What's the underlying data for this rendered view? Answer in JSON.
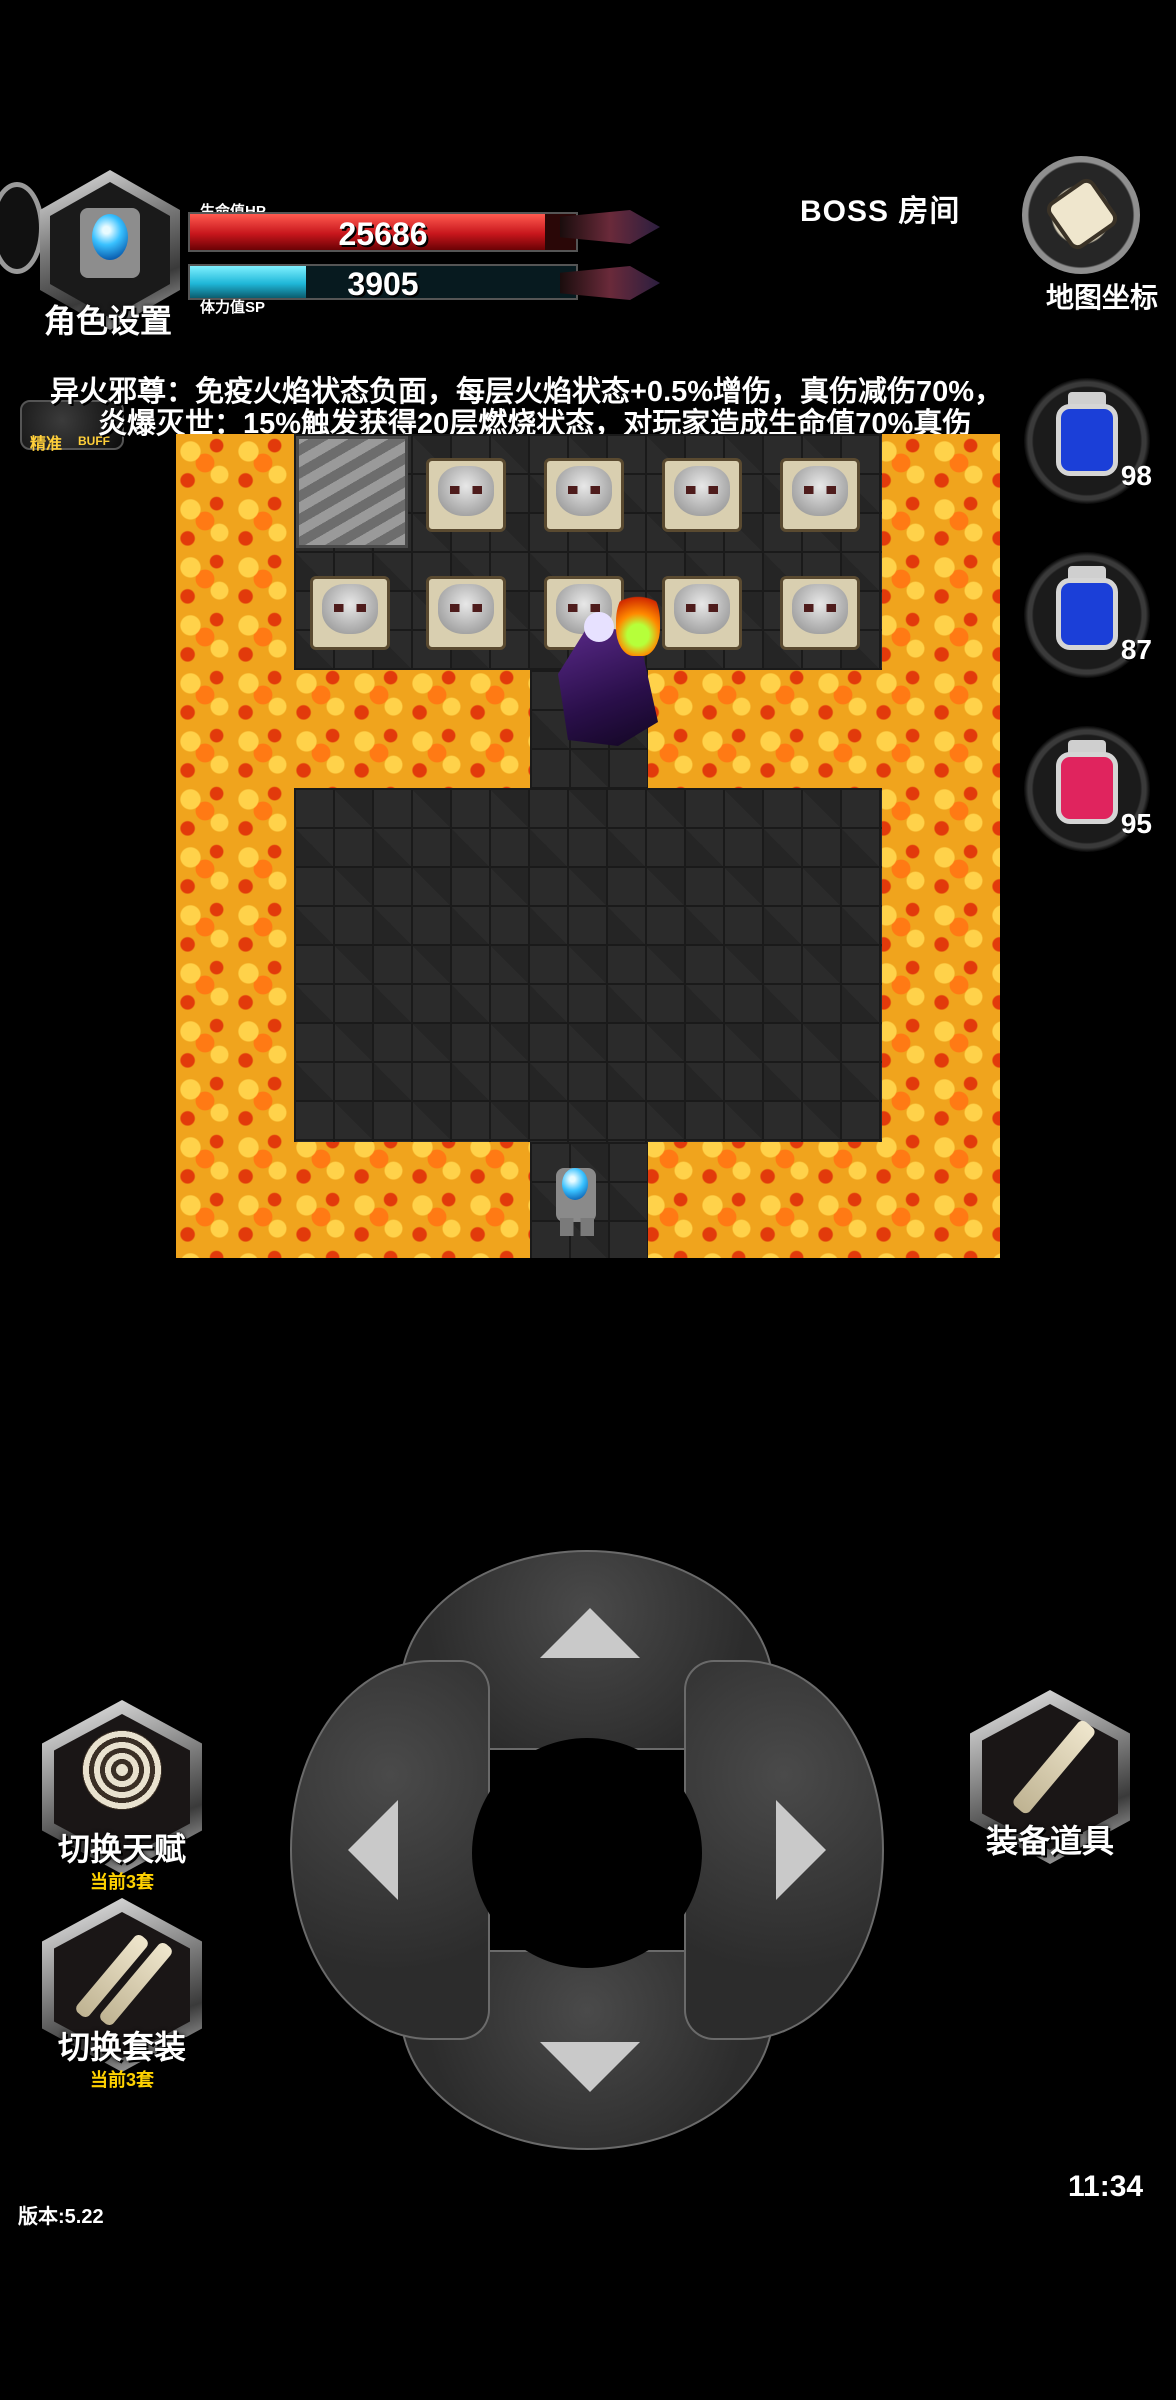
{
  "character": {
    "label": "角色设置"
  },
  "hp": {
    "label": "生命值HP",
    "value": "25686",
    "fill_fraction": 0.92
  },
  "sp": {
    "label": "体力值SP",
    "value": "3905",
    "fill_fraction": 0.3
  },
  "room": {
    "title": "BOSS  房间"
  },
  "map_button": {
    "label": "地图坐标"
  },
  "effects": [
    {
      "text": "异火邪尊：免疫火焰状态负面，每层火焰状态+0.5%增伤，真伤减伤70%，"
    },
    {
      "text": "炎爆灭世：15%触发获得20层燃烧状态，对玩家造成生命值70%真伤"
    }
  ],
  "buff": {
    "label": "精准",
    "sub": "BUFF"
  },
  "potions": [
    {
      "name": "blue-potion",
      "count": "98",
      "color": "#1b3fd8"
    },
    {
      "name": "blue-potion",
      "count": "87",
      "color": "#1b3fd8"
    },
    {
      "name": "pink-potion",
      "count": "95",
      "color": "#e0245e"
    }
  ],
  "controls": {
    "talent": {
      "label": "切换天赋",
      "sub": "当前3套"
    },
    "outfit": {
      "label": "切换套装",
      "sub": "当前3套"
    },
    "equipment": {
      "label": "装备道具"
    }
  },
  "footer": {
    "version": "版本:5.22",
    "time": "11:34"
  },
  "colors": {
    "hp": "#d81f25",
    "sp": "#23bfe0",
    "lava": "#f0a41d",
    "floor": "#2b2b2b",
    "accent_sub": "#ffd200"
  }
}
